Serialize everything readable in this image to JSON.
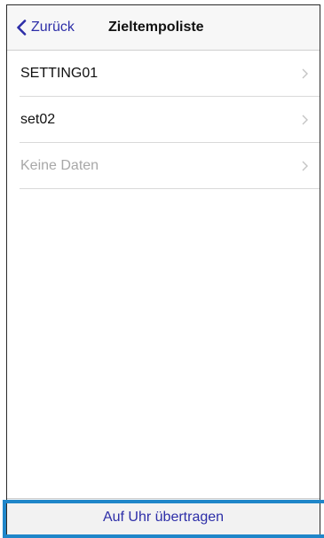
{
  "navbar": {
    "back_label": "Zurück",
    "title": "Zieltempoliste"
  },
  "list": {
    "items": [
      {
        "label": "SETTING01",
        "muted": false
      },
      {
        "label": "set02",
        "muted": false
      },
      {
        "label": "Keine Daten",
        "muted": true
      }
    ]
  },
  "bottom_bar": {
    "transfer_label": "Auf Uhr übertragen"
  },
  "icons": {
    "back": "chevron-left-icon",
    "row": "chevron-right-icon"
  },
  "colors": {
    "accent": "#2d2ea8",
    "highlight": "#1f86c9",
    "muted_text": "#a8a8a8"
  }
}
